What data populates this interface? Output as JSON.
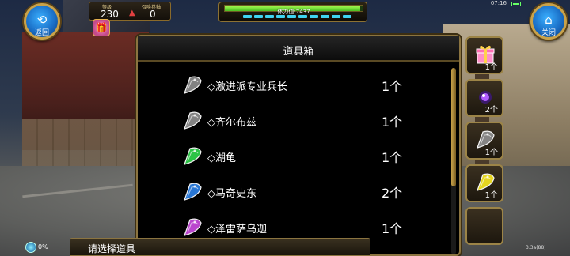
{
  "status_bar": {
    "time": "07:16"
  },
  "player": {
    "level_label": "等级",
    "level": "230",
    "boss_label": "召唤卷轴",
    "boss_count": "0"
  },
  "stamina": {
    "label": "体力值:7437",
    "fill_fraction": 0.98
  },
  "buttons": {
    "back": "返回",
    "close": "关闭"
  },
  "inventory": {
    "title": "道具箱",
    "items": [
      {
        "name": "◇激进派专业兵长",
        "count": "1个",
        "gem_color": "#8a8a8a"
      },
      {
        "name": "◇齐尔布兹",
        "count": "1个",
        "gem_color": "#8a8a8a"
      },
      {
        "name": "◇湖龟",
        "count": "1个",
        "gem_color": "#2fcf4a"
      },
      {
        "name": "◇马奇史东",
        "count": "2个",
        "gem_color": "#2b7de0"
      },
      {
        "name": "◇泽雷萨乌迦",
        "count": "1个",
        "gem_color": "#c44ad8"
      }
    ]
  },
  "side_slots": [
    {
      "icon": "gift-box-icon",
      "count": "1个"
    },
    {
      "icon": "purple-orb-icon",
      "count": "2个"
    },
    {
      "icon": "gray-gem-icon",
      "count": "1个"
    },
    {
      "icon": "yellow-gem-icon",
      "count": "1个"
    },
    {
      "icon": "empty-slot",
      "count": ""
    }
  ],
  "bottom": {
    "prompt": "请选择道具",
    "exp_percent": "0%",
    "version": "3.3a(88)"
  }
}
